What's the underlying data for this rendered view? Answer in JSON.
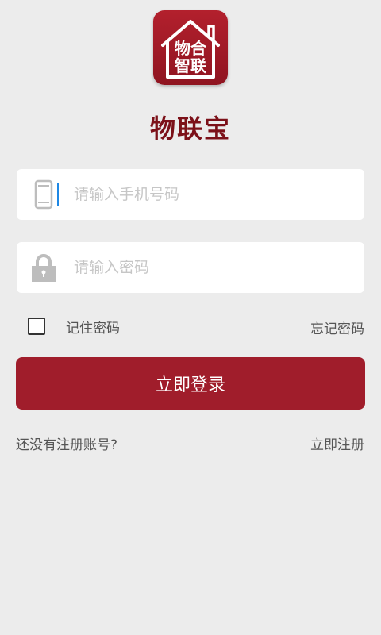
{
  "logo": {
    "line1": "物合",
    "line2": "智联"
  },
  "app": {
    "name": "物联宝"
  },
  "form": {
    "phone_placeholder": "请输入手机号码",
    "phone_value": "",
    "password_placeholder": "请输入密码",
    "password_value": "",
    "remember_label": "记住密码",
    "remember_checked": false,
    "forgot_label": "忘记密码"
  },
  "actions": {
    "login_label": "立即登录",
    "no_account_label": "还没有注册账号?",
    "register_label": "立即注册"
  },
  "icons": {
    "phone": "phone-icon",
    "lock": "lock-icon",
    "logo": "house-icon"
  },
  "colors": {
    "brand": "#a01d2b",
    "title": "#7c1119",
    "background": "#ececec",
    "caret": "#1e88e5"
  }
}
